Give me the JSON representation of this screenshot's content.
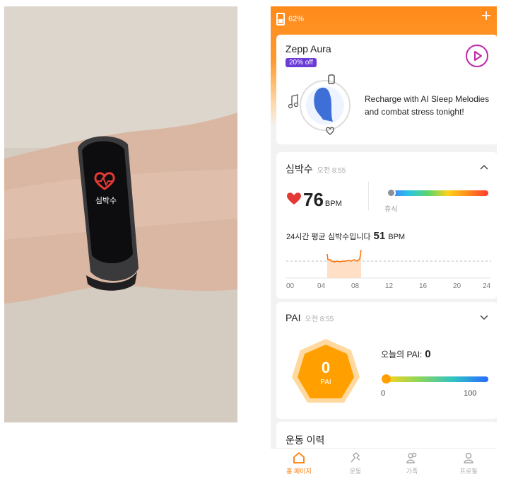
{
  "photo": {
    "watch_label": "심박수"
  },
  "status": {
    "battery": "62%",
    "add_icon": "plus-icon"
  },
  "promo": {
    "title": "Zepp Aura",
    "badge": "20% off",
    "text_line1": "Recharge with AI Sleep Melodies",
    "text_line2": "and combat stress tonight!"
  },
  "heart": {
    "title": "심박수",
    "time": "오전 8:55",
    "value": "76",
    "unit": "BPM",
    "zone_label": "휴식",
    "avg_label": "24시간 평균 심박수입니다",
    "avg_value": "51",
    "avg_unit": "BPM",
    "chart_ticks": [
      "00",
      "04",
      "08",
      "12",
      "16",
      "20",
      "24"
    ]
  },
  "pai": {
    "title": "PAI",
    "time": "오전 8:55",
    "value": "0",
    "label": "PAI",
    "today_label": "오늘의 PAI:",
    "today_value": "0",
    "scale_min": "0",
    "scale_max": "100"
  },
  "workout": {
    "title": "운동 이력"
  },
  "tabs": [
    {
      "label": "홈 페이지",
      "icon": "home-icon"
    },
    {
      "label": "운동",
      "icon": "run-icon"
    },
    {
      "label": "가족",
      "icon": "family-icon"
    },
    {
      "label": "프로필",
      "icon": "profile-icon"
    }
  ],
  "colors": {
    "accent": "#ff7a00",
    "heart": "#e53935",
    "pai": "#ffa000"
  }
}
